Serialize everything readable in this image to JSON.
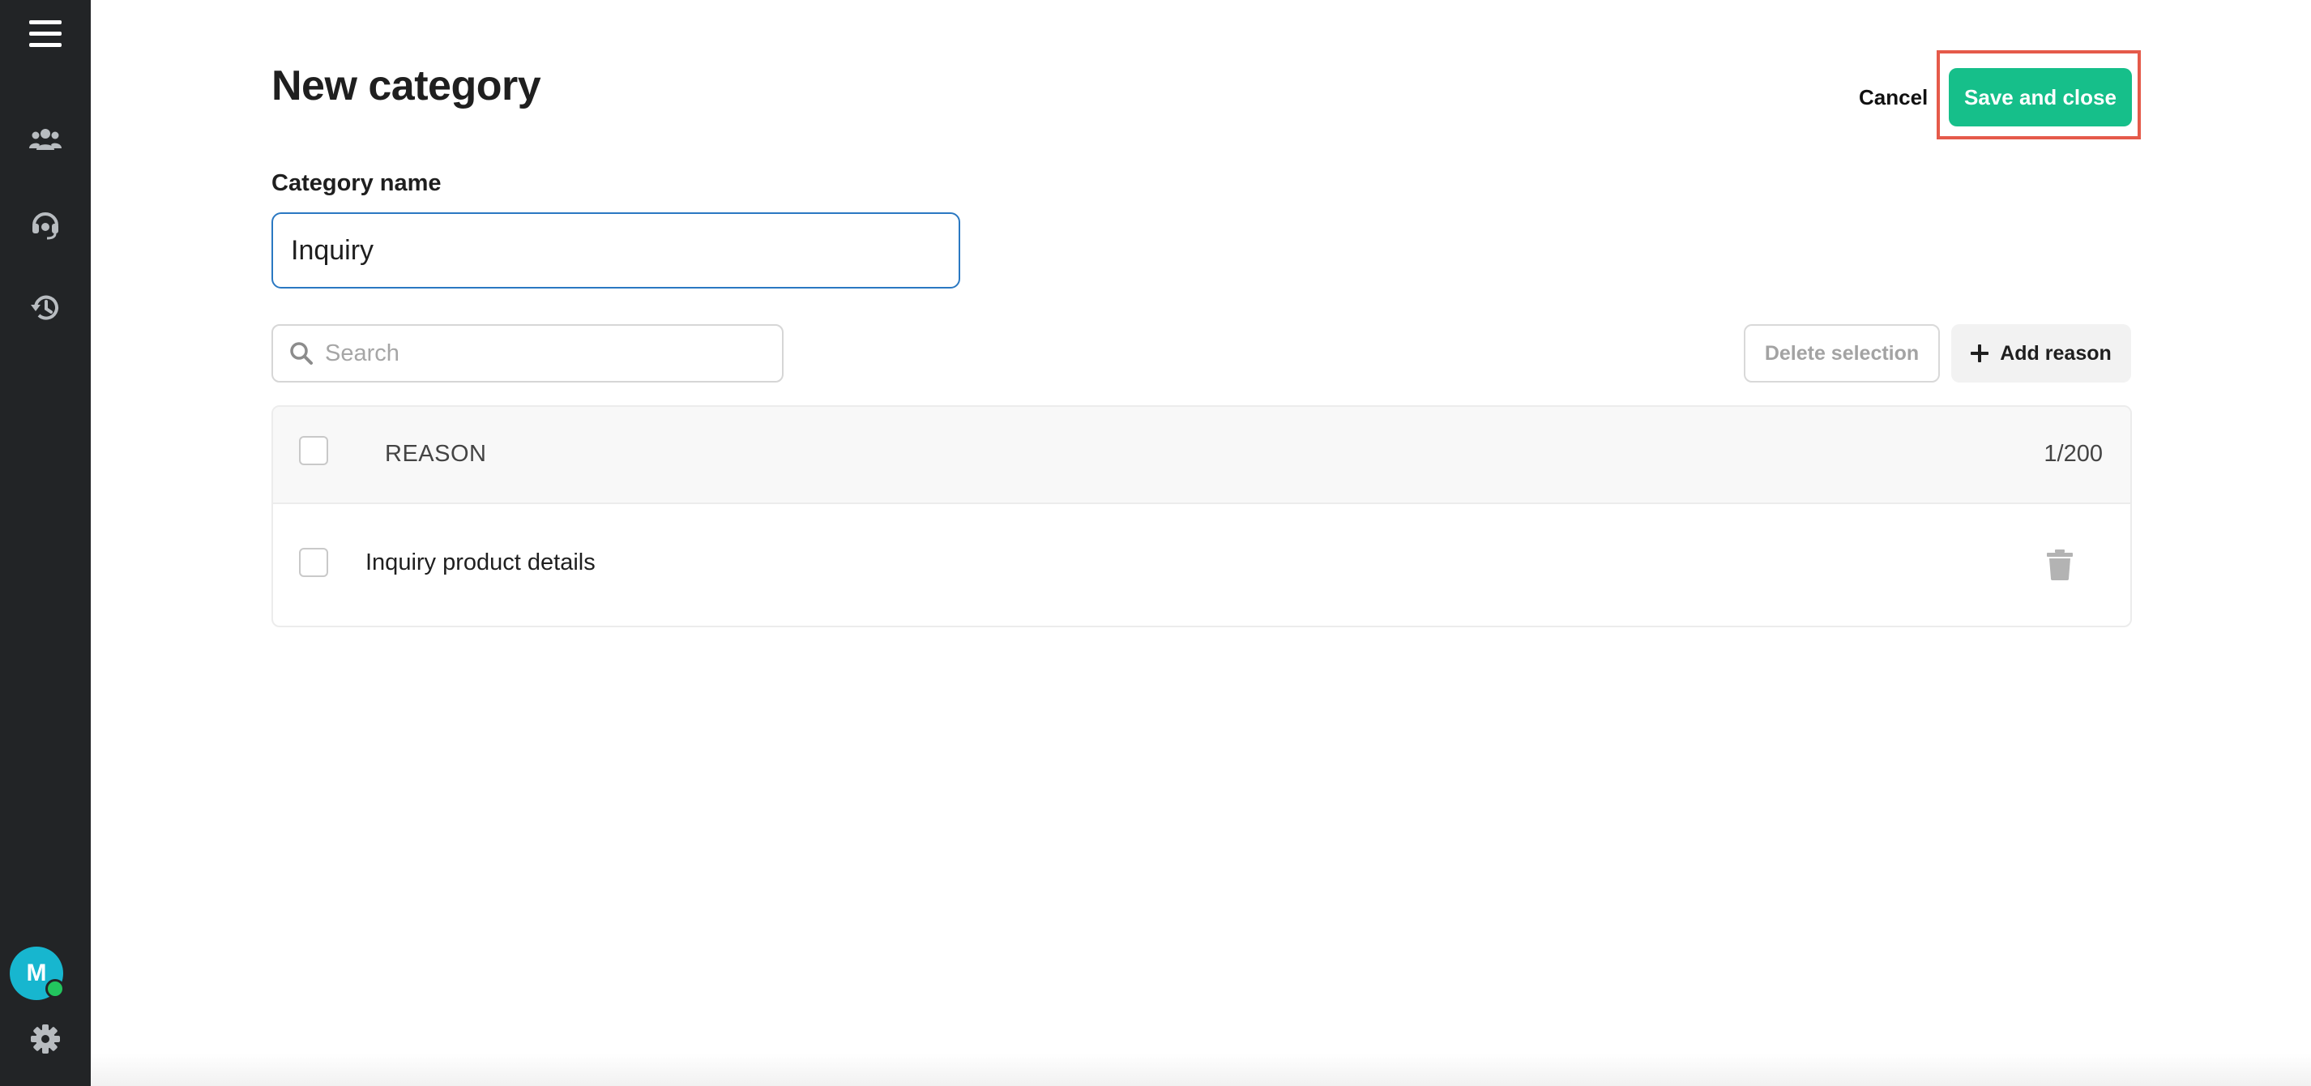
{
  "sidebar": {
    "menu_icon": "hamburger-menu-icon",
    "items": [
      {
        "icon": "users-icon"
      },
      {
        "icon": "headset-icon"
      },
      {
        "icon": "history-icon"
      }
    ],
    "avatar_initial": "M",
    "settings_icon": "gear-icon"
  },
  "header": {
    "title": "New category",
    "cancel_label": "Cancel",
    "save_label": "Save and close"
  },
  "form": {
    "category_label": "Category name",
    "category_value": "Inquiry"
  },
  "toolbar": {
    "search_placeholder": "Search",
    "delete_label": "Delete selection",
    "add_label": "Add reason"
  },
  "table": {
    "column_header": "REASON",
    "count": "1/200",
    "rows": [
      {
        "reason": "Inquiry product details"
      }
    ]
  },
  "colors": {
    "sidebar_bg": "#222426",
    "primary_green": "#16bf8a",
    "input_focus": "#2a78c2",
    "highlight": "#e55a4a",
    "avatar_bg": "#17b6cf"
  }
}
